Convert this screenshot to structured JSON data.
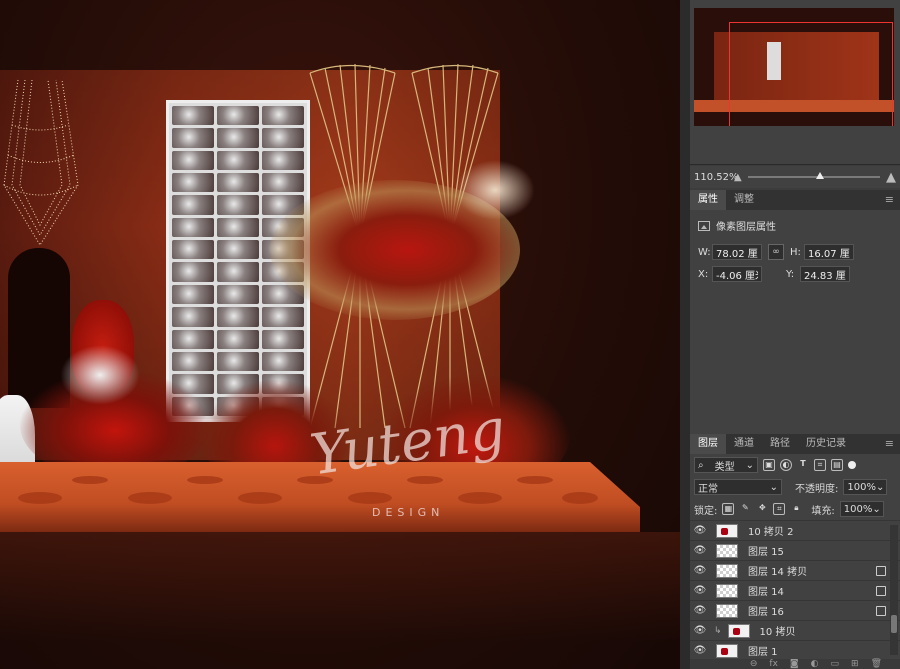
{
  "navigator": {
    "zoom": "110.52%"
  },
  "properties": {
    "tabs": [
      "属性",
      "调整"
    ],
    "section_title": "像素图层属性",
    "w_label": "W:",
    "w_value": "78.02 厘米",
    "h_label": "H:",
    "h_value": "16.07 厘米",
    "x_label": "X:",
    "x_value": "-4.06 厘米",
    "y_label": "Y:",
    "y_value": "24.83 厘米"
  },
  "layers_panel": {
    "tabs": [
      "图层",
      "通道",
      "路径",
      "历史记录"
    ],
    "filter_kind": "类型",
    "blend_mode": "正常",
    "opacity_label": "不透明度:",
    "opacity_value": "100%",
    "lock_label": "锁定:",
    "fill_label": "填充:",
    "fill_value": "100%",
    "layers": [
      {
        "name": "10 拷贝 2",
        "thumb": "red",
        "smart": false,
        "clipped": false
      },
      {
        "name": "图层 15",
        "thumb": "trans",
        "smart": false,
        "clipped": false
      },
      {
        "name": "图层 14 拷贝",
        "thumb": "trans",
        "smart": true,
        "clipped": false
      },
      {
        "name": "图层 14",
        "thumb": "trans",
        "smart": true,
        "clipped": false
      },
      {
        "name": "图层 16",
        "thumb": "trans",
        "smart": true,
        "clipped": false
      },
      {
        "name": "10 拷贝",
        "thumb": "red",
        "smart": false,
        "clipped": true
      },
      {
        "name": "图层 1",
        "thumb": "red",
        "smart": false,
        "clipped": false
      }
    ]
  },
  "watermark": {
    "script": "Yuteng",
    "sub": "DESIGN"
  },
  "colors": {
    "panel_bg": "#414141",
    "stage": "#c04d22",
    "wall": "#8b2d16"
  }
}
